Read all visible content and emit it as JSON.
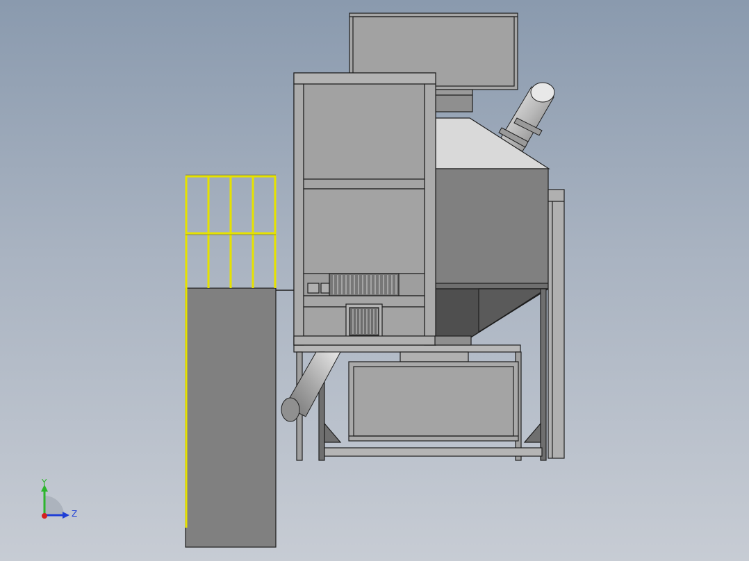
{
  "viewport": {
    "background_top": "#8a9aae",
    "background_bottom": "#c7ccd4"
  },
  "triad": {
    "y_label": "Y",
    "z_label": "Z",
    "y_color": "#2db52d",
    "z_color": "#1f3fd6",
    "x_color": "#d42020"
  },
  "colors": {
    "railing": "#e6e200",
    "steel_dark": "#6f6f6f",
    "panel_mid": "#a3a3a3",
    "panel_dark": "#808080",
    "panel_light": "#d9d9d9",
    "outline": "#1e1e1e"
  }
}
